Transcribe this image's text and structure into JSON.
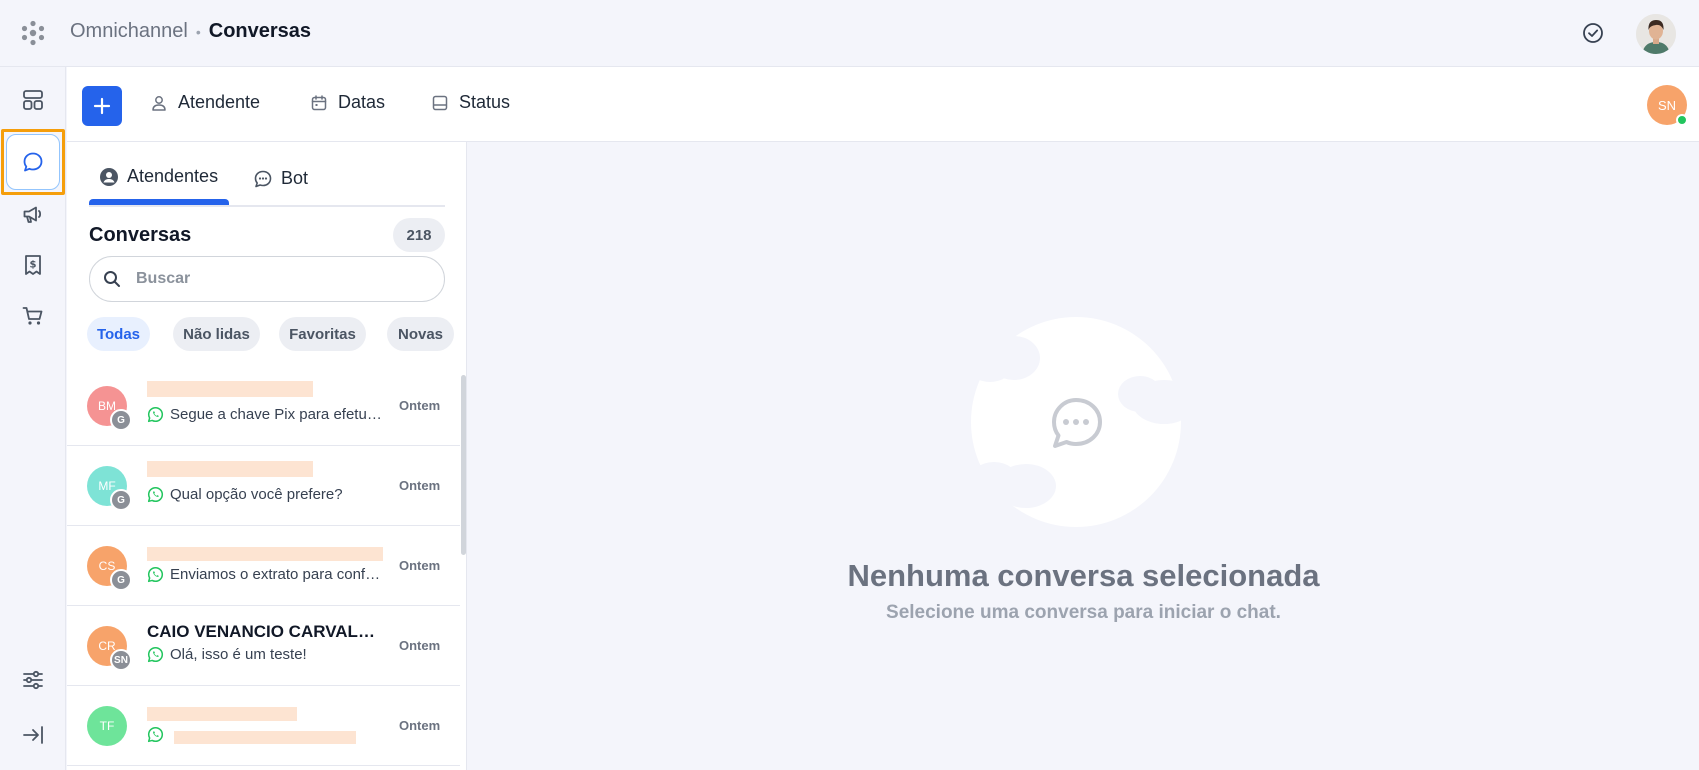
{
  "header": {
    "breadcrumb_parent": "Omnichannel",
    "breadcrumb_separator": "•",
    "breadcrumb_current": "Conversas"
  },
  "rail": {
    "items": [
      {
        "icon": "dashboard-icon"
      },
      {
        "icon": "chat-bubble-icon",
        "active": true
      },
      {
        "icon": "megaphone-icon"
      },
      {
        "icon": "receipt-icon"
      },
      {
        "icon": "cart-icon"
      },
      {
        "icon": "sliders-icon"
      },
      {
        "icon": "collapse-arrow-icon"
      }
    ]
  },
  "toolbar": {
    "add_icon": "plus-icon",
    "filters": [
      {
        "label": "Atendente",
        "icon": "person-icon"
      },
      {
        "label": "Datas",
        "icon": "calendar-icon"
      },
      {
        "label": "Status",
        "icon": "inbox-icon"
      }
    ],
    "user_initials": "SN"
  },
  "tabs": [
    {
      "label": "Atendentes",
      "icon": "user-circle-icon",
      "active": true
    },
    {
      "label": "Bot",
      "icon": "chat-dots-icon",
      "active": false
    }
  ],
  "list": {
    "title": "Conversas",
    "count": "218",
    "search_placeholder": "Buscar",
    "chips": [
      "Todas",
      "Não lidas",
      "Favoritas",
      "Novas"
    ],
    "active_chip": "Todas",
    "conversations": [
      {
        "initials": "BM",
        "sub": "G",
        "name": "",
        "message": "Segue a chave Pix para efetuar...",
        "time": "Ontem",
        "color": "#f59393"
      },
      {
        "initials": "MF",
        "sub": "G",
        "name": "",
        "message": "Qual opção você prefere?",
        "time": "Ontem",
        "color": "#7ee3d6"
      },
      {
        "initials": "CS",
        "sub": "G",
        "name": "",
        "message": "Enviamos o extrato para confer...",
        "time": "Ontem",
        "color": "#f7a36a"
      },
      {
        "initials": "CR",
        "sub": "SN",
        "name": "CAIO VENANCIO CARVALH...",
        "message": "Olá, isso é um teste!",
        "time": "Ontem",
        "color": "#f7a36a"
      },
      {
        "initials": "TF",
        "sub": "",
        "name": "",
        "message": "",
        "time": "Ontem",
        "color": "#6ee49a"
      }
    ]
  },
  "empty_state": {
    "title": "Nenhuma conversa selecionada",
    "subtitle": "Selecione uma conversa para iniciar o chat."
  },
  "colors": {
    "accent": "#2563eb",
    "whatsapp": "#22c55e",
    "highlight_outline": "#f59e0b"
  }
}
